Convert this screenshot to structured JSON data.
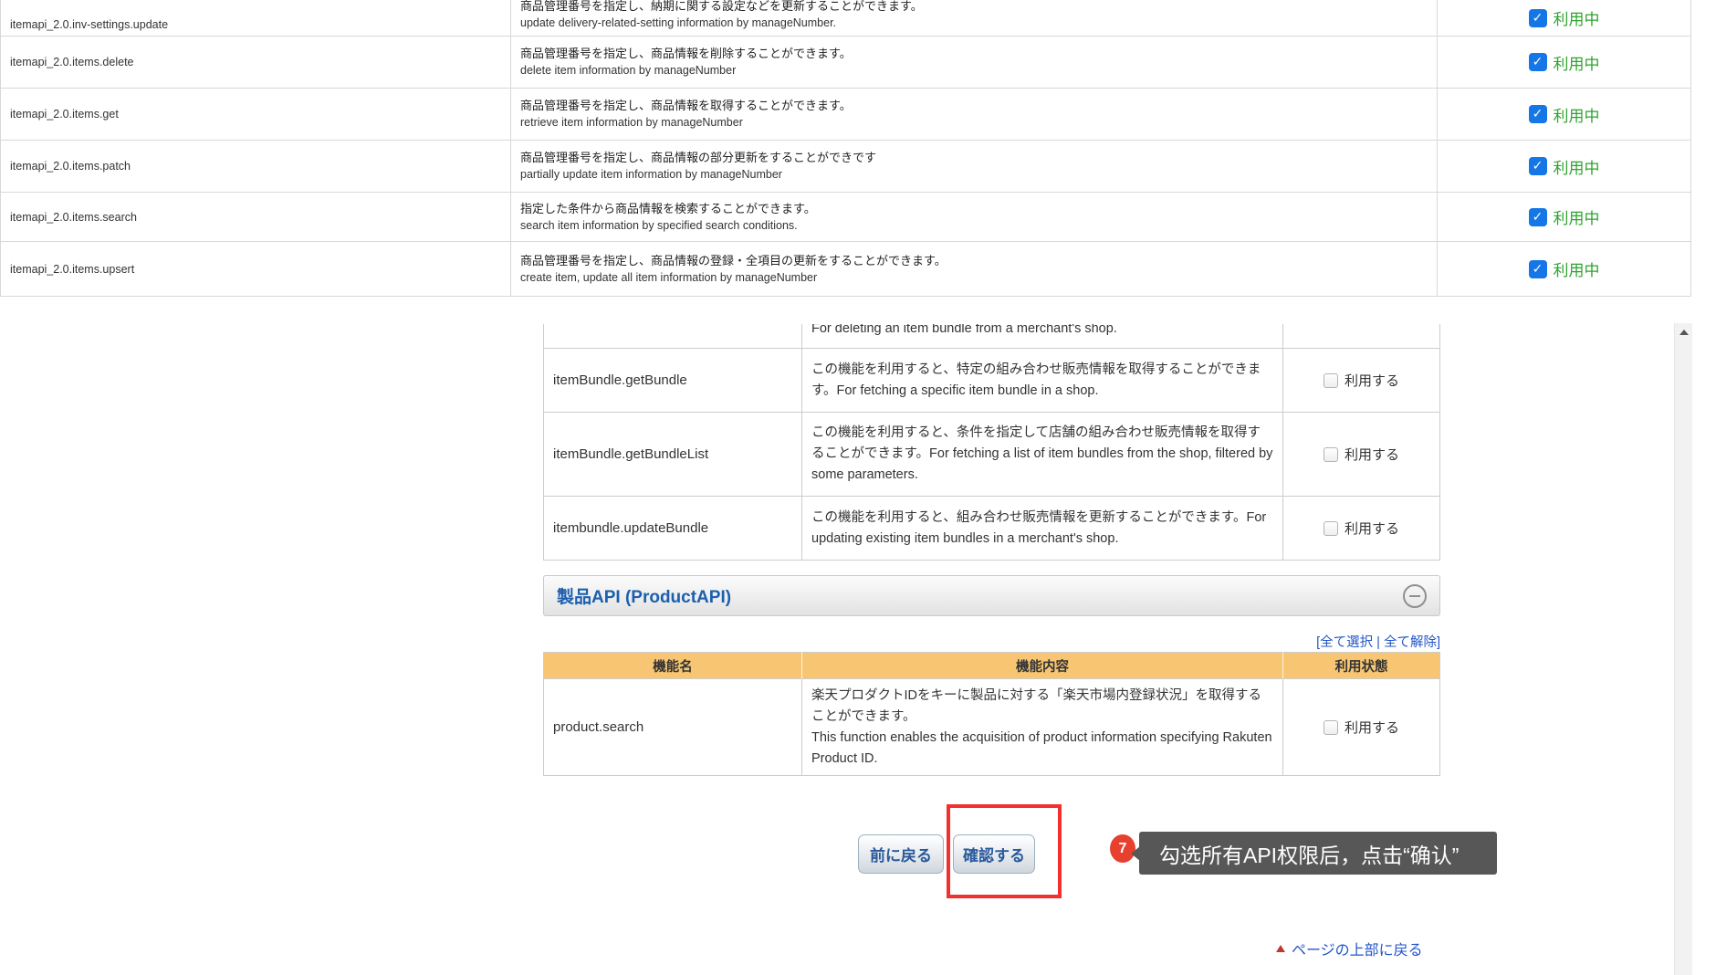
{
  "colors": {
    "checkbox_checked_blue": "#1576e8",
    "in_use_green": "#2da42d",
    "annotation_red": "#f23030",
    "tooltip_bg": "#575757",
    "table_header_orange": "#f8c673",
    "link_blue": "#2356c8",
    "section_title_blue": "#1c5fae"
  },
  "top_table": {
    "rows": [
      {
        "name": "itemapi_2.0.inv-settings.update",
        "desc_ja": "商品管理番号を指定し、納期に関する設定などを更新することができます。",
        "desc_en": "update delivery-related-setting information by manageNumber.",
        "status": "利用中",
        "status_checked": true
      },
      {
        "name": "itemapi_2.0.items.delete",
        "desc_ja": "商品管理番号を指定し、商品情報を削除することができます。",
        "desc_en": "delete item information by manageNumber",
        "status": "利用中",
        "status_checked": true
      },
      {
        "name": "itemapi_2.0.items.get",
        "desc_ja": "商品管理番号を指定し、商品情報を取得することができます。",
        "desc_en": "retrieve item information by manageNumber",
        "status": "利用中",
        "status_checked": true
      },
      {
        "name": "itemapi_2.0.items.patch",
        "desc_ja": "商品管理番号を指定し、商品情報の部分更新をすることができです",
        "desc_en": "partially update item information by manageNumber",
        "status": "利用中",
        "status_checked": true
      },
      {
        "name": "itemapi_2.0.items.search",
        "desc_ja": "指定した条件から商品情報を検索することができます。",
        "desc_en": "search item information by specified search conditions.",
        "status": "利用中",
        "status_checked": true
      },
      {
        "name": "itemapi_2.0.items.upsert",
        "desc_ja": "商品管理番号を指定し、商品情報の登録・全項目の更新をすることができます。",
        "desc_en": "create item, update all item information by manageNumber",
        "status": "利用中",
        "status_checked": true
      }
    ]
  },
  "bundle_table": {
    "partial_row_text": "For deleting an item bundle from a merchant's shop.",
    "rows": [
      {
        "name": "itemBundle.getBundle",
        "desc": "この機能を利用すると、特定の組み合わせ販売情報を取得することができます。For fetching a specific item bundle in a shop.",
        "checkbox_label": "利用する",
        "checked": false
      },
      {
        "name": "itemBundle.getBundleList",
        "desc": "この機能を利用すると、条件を指定して店舗の組み合わせ販売情報を取得することができます。For fetching a list of item bundles from the shop, filtered by some parameters.",
        "checkbox_label": "利用する",
        "checked": false
      },
      {
        "name": "itembundle.updateBundle",
        "desc": "この機能を利用すると、組み合わせ販売情報を更新することができます。For updating existing item bundles in a merchant's shop.",
        "checkbox_label": "利用する",
        "checked": false
      }
    ]
  },
  "product_section": {
    "title": "製品API (ProductAPI)",
    "links_open": "[",
    "select_all_label": "全て選択",
    "links_separator": " | ",
    "deselect_all_label": "全て解除",
    "links_close": "]",
    "headers": [
      "機能名",
      "機能内容",
      "利用状態"
    ],
    "rows": [
      {
        "name": "product.search",
        "desc_ja": "楽天プロダクトIDをキーに製品に対する「楽天市場内登録状況」を取得することができます。",
        "desc_en": "This function enables the acquisition of product information specifying Rakuten Product ID.",
        "checkbox_label": "利用する",
        "checked": false
      }
    ]
  },
  "buttons": {
    "back": "前に戻る",
    "confirm": "確認する"
  },
  "annotation": {
    "step_number": "7",
    "tooltip_text": "勾选所有API权限后，点击“确认”"
  },
  "footer": {
    "back_to_top": "ページの上部に戻る"
  }
}
